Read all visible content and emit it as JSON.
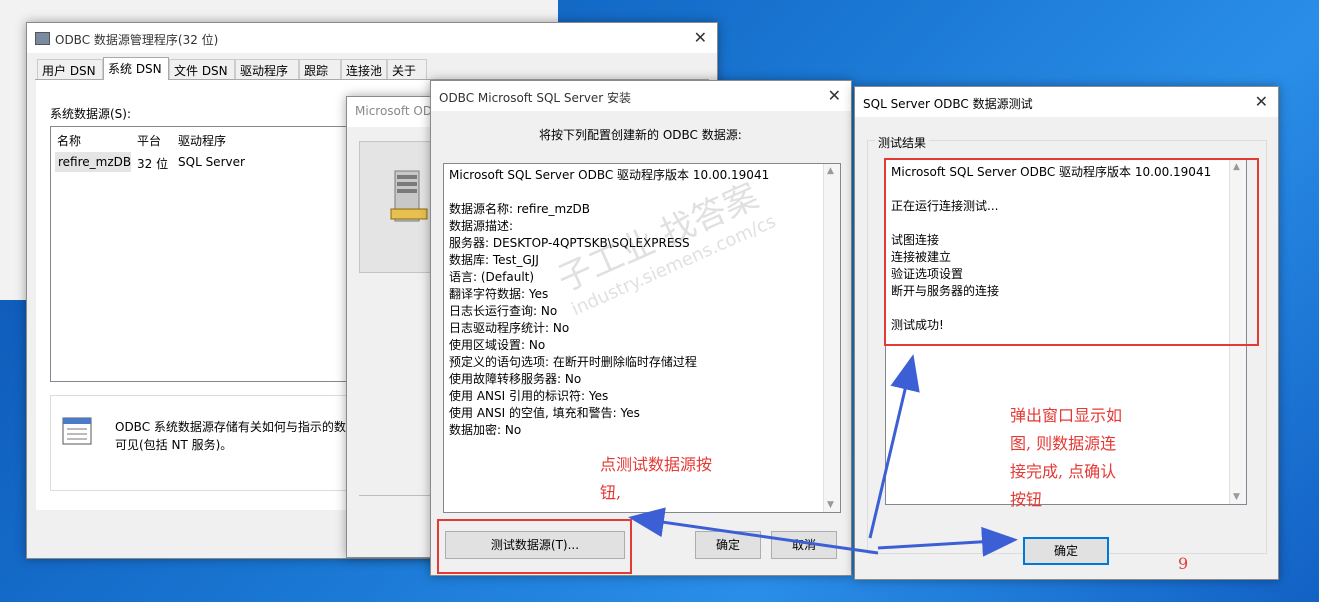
{
  "win_main": {
    "title": "ODBC 数据源管理程序(32 位)",
    "tabs": [
      "用户 DSN",
      "系统 DSN",
      "文件 DSN",
      "驱动程序",
      "跟踪",
      "连接池",
      "关于"
    ],
    "active_tab": "系统 DSN",
    "list_label": "系统数据源(S):",
    "columns": [
      "名称",
      "平台",
      "驱动程序"
    ],
    "row": {
      "name": "refire_mzDB",
      "platform": "32 位",
      "driver": "SQL Server"
    },
    "info_line1": "ODBC 系统数据源存储有关如何与指示的数",
    "info_line2": "可见(包括 NT 服务)。",
    "close": "✕"
  },
  "win_create": {
    "title": "Microsoft OD"
  },
  "win_setup": {
    "title": "ODBC Microsoft SQL Server 安装",
    "heading": "将按下列配置创建新的 ODBC 数据源:",
    "lines": [
      "Microsoft SQL Server ODBC 驱动程序版本 10.00.19041",
      "",
      "数据源名称: refire_mzDB",
      "数据源描述:",
      "服务器: DESKTOP-4QPTSKB\\SQLEXPRESS",
      "数据库: Test_GJJ",
      "语言: (Default)",
      "翻译字符数据: Yes",
      "日志长运行查询: No",
      "日志驱动程序统计: No",
      "使用区域设置: No",
      "预定义的语句选项: 在断开时删除临时存储过程",
      "使用故障转移服务器: No",
      "使用 ANSI 引用的标识符: Yes",
      "使用 ANSI 的空值, 填充和警告: Yes",
      "数据加密: No"
    ],
    "test_button": "测试数据源(T)...",
    "ok_button": "确定",
    "cancel_button": "取消",
    "close": "✕"
  },
  "win_test": {
    "title": "SQL Server ODBC 数据源测试",
    "group_label": "测试结果",
    "lines": [
      "Microsoft SQL Server ODBC 驱动程序版本 10.00.19041",
      "",
      "正在运行连接测试...",
      "",
      "试图连接",
      "连接被建立",
      "验证选项设置",
      "断开与服务器的连接",
      "",
      "测试成功!"
    ],
    "ok_button": "确定",
    "close": "✕"
  },
  "annotations": {
    "note_test_1": "点测试数据源按",
    "note_test_2": "钮,",
    "note_popup_1": "弹出窗口显示如",
    "note_popup_2": "图, 则数据源连",
    "note_popup_3": "接完成, 点确认",
    "note_popup_4": "按钮",
    "step_number": "9",
    "color": "#e53935",
    "arrow_color": "#3d5fd6"
  },
  "watermark": {
    "cn": "子工业 找答案",
    "en": "industry.siemens.com/cs"
  }
}
